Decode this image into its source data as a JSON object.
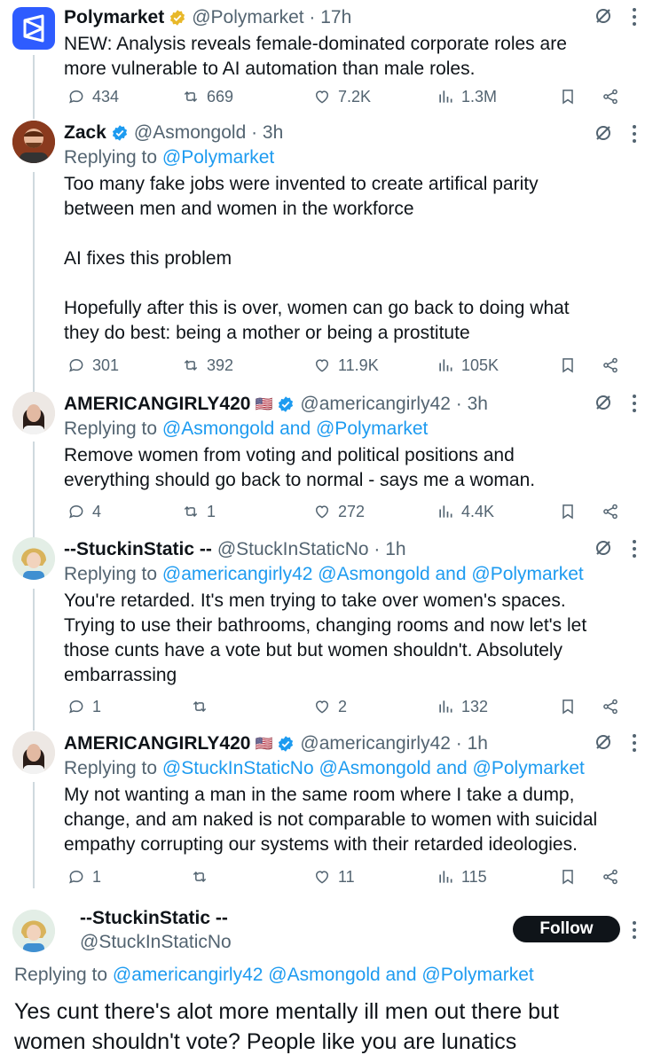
{
  "tweets": [
    {
      "name": "Polymarket",
      "handle": "@Polymarket · 17h",
      "reply_prefix": "",
      "reply_links": "",
      "body": "NEW: Analysis reveals female-dominated corporate roles are\nmore vulnerable to AI automation than male roles.",
      "replies": "434",
      "retweets": "669",
      "likes": "7.2K",
      "views": "1.3M"
    },
    {
      "name": "Zack",
      "handle": "@Asmongold · 3h",
      "reply_prefix": "Replying to ",
      "reply_links": "@Polymarket",
      "body": "Too many fake jobs were invented to create artifical parity\nbetween men and women in the workforce\n\nAI fixes this problem\n\nHopefully after this is over, women can go back to doing what\nthey do best: being a mother or being a prostitute",
      "replies": "301",
      "retweets": "392",
      "likes": "11.9K",
      "views": "105K"
    },
    {
      "name": "AMERICANGIRLY420",
      "handle": "@americangirly42 · 3h",
      "reply_prefix": "Replying to ",
      "reply_links": "@Asmongold and @Polymarket",
      "body": "Remove women from voting and political positions and\neverything should go back to normal - says me a woman.",
      "replies": "4",
      "retweets": "1",
      "likes": "272",
      "views": "4.4K"
    },
    {
      "name": "--StuckinStatic --",
      "handle": "@StuckInStaticNo · 1h",
      "reply_prefix": "Replying to ",
      "reply_links": "@americangirly42 @Asmongold and @Polymarket",
      "body": "You're retarded. It's men trying to take over women's spaces.\nTrying to use their bathrooms, changing rooms and now let's let\nthose cunts have a vote but but women shouldn't. Absolutely\nembarrassing",
      "replies": "1",
      "retweets": "",
      "likes": "2",
      "views": "132"
    },
    {
      "name": "AMERICANGIRLY420",
      "handle": "@americangirly42 · 1h",
      "reply_prefix": "Replying to ",
      "reply_links": "@StuckInStaticNo @Asmongold and @Polymarket",
      "body": "My not wanting a man in the same room where I take a dump,\nchange, and am naked is not comparable to women with suicidal\nempathy corrupting our systems with their retarded ideologies.",
      "replies": "1",
      "retweets": "",
      "likes": "11",
      "views": "115"
    }
  ],
  "focused": {
    "name": "--StuckinStatic --",
    "handle": "@StuckInStaticNo",
    "follow_label": "Follow",
    "reply_prefix": "Replying to ",
    "reply_links": "@americangirly42 @Asmongold and @Polymarket",
    "body": "Yes cunt there's alot more mentally ill men out there but\nwomen shouldn't vote? People like you are lunatics"
  },
  "colors": {
    "accent": "#1d9bf0",
    "muted": "#536471",
    "text": "#0f1419",
    "gold_badge": "#e8b829"
  }
}
